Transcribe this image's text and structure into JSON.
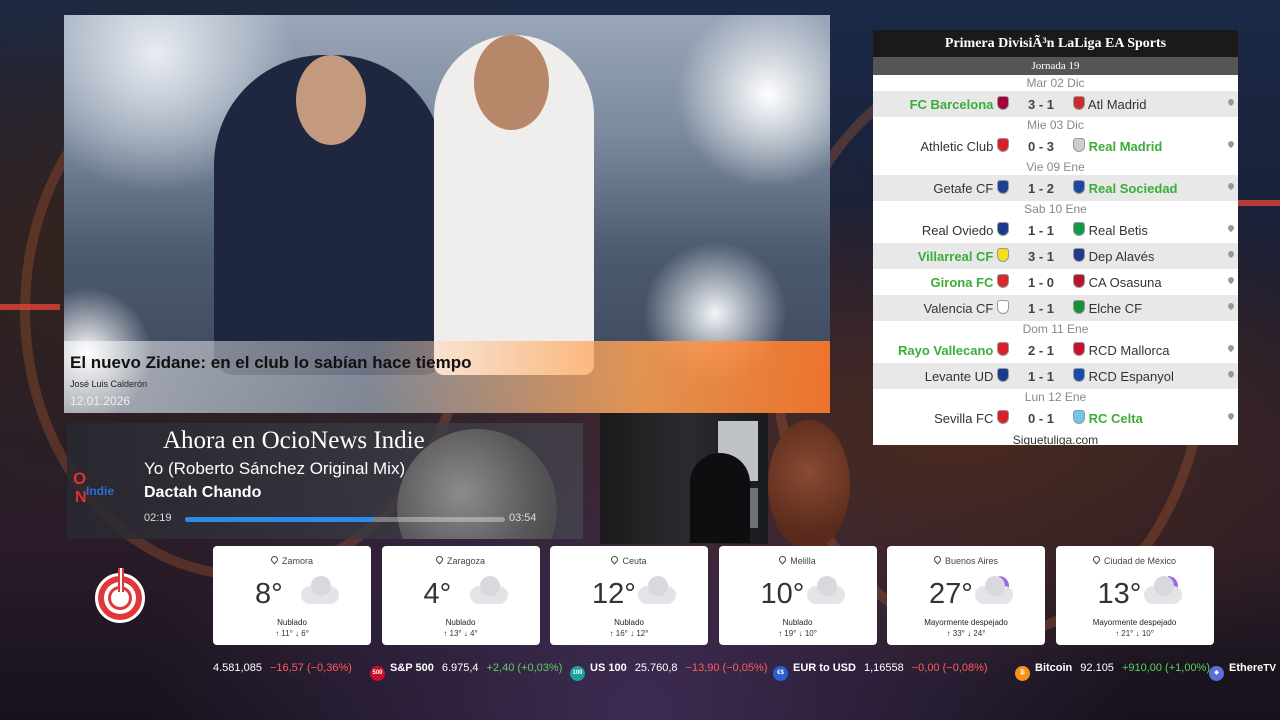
{
  "news": {
    "title": "El nuevo Zidane: en el club lo sabían hace tiempo",
    "author": "José Luis Calderón",
    "date": "12.01.2026"
  },
  "league": {
    "title": "Primera DivisiÃ³n LaLiga EA Sports",
    "round": "Jornada 19",
    "footer": "Siguetuliga.com",
    "days": [
      {
        "date": "Mar 02 Dic",
        "matches": [
          {
            "home": "FC Barcelona",
            "score": "3 - 1",
            "away": "Atl Madrid",
            "winner": "home",
            "home_color": "#a5003c",
            "away_color": "#cc2b2b"
          }
        ]
      },
      {
        "date": "Mie 03 Dic",
        "matches": [
          {
            "home": "Athletic Club",
            "score": "0 - 3",
            "away": "Real Madrid",
            "winner": "away",
            "home_color": "#d8202a",
            "away_color": "#cccccc"
          }
        ]
      },
      {
        "date": "Vie 09 Ene",
        "matches": [
          {
            "home": "Getafe CF",
            "score": "1 - 2",
            "away": "Real Sociedad",
            "winner": "away",
            "home_color": "#1f3f8f",
            "away_color": "#1a4aa0"
          }
        ]
      },
      {
        "date": "Sab 10 Ene",
        "matches": [
          {
            "home": "Real Oviedo",
            "score": "1 - 1",
            "away": "Real Betis",
            "winner": "none",
            "home_color": "#1c3a8c",
            "away_color": "#0f9a4a"
          },
          {
            "home": "Villarreal CF",
            "score": "3 - 1",
            "away": "Dep Alavés",
            "winner": "home",
            "home_color": "#f2e01a",
            "away_color": "#1f3a8c"
          },
          {
            "home": "Girona FC",
            "score": "1 - 0",
            "away": "CA Osasuna",
            "winner": "home",
            "home_color": "#d72a2a",
            "away_color": "#b5142a"
          },
          {
            "home": "Valencia CF",
            "score": "1 - 1",
            "away": "Elche CF",
            "winner": "none",
            "home_color": "#ffffff",
            "away_color": "#1a8f3a"
          }
        ]
      },
      {
        "date": "Dom 11 Ene",
        "matches": [
          {
            "home": "Rayo Vallecano",
            "score": "2 - 1",
            "away": "RCD Mallorca",
            "winner": "home",
            "home_color": "#d8202a",
            "away_color": "#c8102e"
          },
          {
            "home": "Levante UD",
            "score": "1 - 1",
            "away": "RCD Espanyol",
            "winner": "none",
            "home_color": "#1a3a8c",
            "away_color": "#1a4ab0"
          }
        ]
      },
      {
        "date": "Lun 12 Ene",
        "matches": [
          {
            "home": "Sevilla FC",
            "score": "0 - 1",
            "away": "RC Celta",
            "winner": "away",
            "home_color": "#d8202a",
            "away_color": "#6ec6e8"
          }
        ]
      }
    ]
  },
  "radio": {
    "heading": "Ahora en OcioNews Indie",
    "song": "Yo (Roberto Sánchez Original Mix)",
    "artist": "Dactah Chando",
    "elapsed": "02:19",
    "duration": "03:54",
    "progress": 0.59,
    "logo_o": "O",
    "logo_n": "N",
    "logo_indie": "Indie"
  },
  "weather": [
    {
      "city": "Zamora",
      "temp": "8°",
      "icon": "cloud-icon",
      "desc": "Nublado",
      "range": "↑ 11°  ↓ 6°"
    },
    {
      "city": "Zaragoza",
      "temp": "4°",
      "icon": "cloud-icon",
      "desc": "Nublado",
      "range": "↑ 13°  ↓ 4°"
    },
    {
      "city": "Ceuta",
      "temp": "12°",
      "icon": "cloud-icon",
      "desc": "Nublado",
      "range": "↑ 16°  ↓ 12°"
    },
    {
      "city": "Melilla",
      "temp": "10°",
      "icon": "cloud-icon",
      "desc": "Nublado",
      "range": "↑ 19°  ↓ 10°"
    },
    {
      "city": "Buenos Aires",
      "temp": "27°",
      "icon": "moon-cloud-icon",
      "desc": "Mayormente despejado",
      "range": "↑ 33°  ↓ 24°"
    },
    {
      "city": "Ciudad de México",
      "temp": "13°",
      "icon": "moon-cloud-icon",
      "desc": "Mayormente despejado",
      "range": "↑ 21°  ↓ 10°"
    }
  ],
  "ticker": [
    {
      "badge": "",
      "name": "",
      "value": "4.581,085",
      "change": "−16,57 (−0,36%)",
      "dir": "neg",
      "badge_color": ""
    },
    {
      "badge": "500",
      "name": "S&P 500",
      "value": "6.975,4",
      "change": "+2,40 (+0,03%)",
      "dir": "pos",
      "badge_color": "#c8102e"
    },
    {
      "badge": "100",
      "name": "US 100",
      "value": "25.760,8",
      "change": "−13,90 (−0,05%)",
      "dir": "neg",
      "badge_color": "#1aa0a0"
    },
    {
      "badge": "€$",
      "name": "EUR to USD",
      "value": "1,16558",
      "change": "−0,00 (−0,08%)",
      "dir": "neg",
      "badge_color": "#2a5fd0"
    },
    {
      "badge": "₿",
      "name": "Bitcoin",
      "value": "92.105",
      "change": "+910,00 (+1,00%)",
      "dir": "pos",
      "badge_color": "#f7931a"
    },
    {
      "badge": "◆",
      "name": "Ethere",
      "value": "",
      "change": "",
      "dir": "pos",
      "badge_color": "#5b6fd8"
    }
  ],
  "ticker_logo": "TV",
  "colors": {
    "winner": "#3aae3a",
    "power": "#e03838",
    "progress": "#2e8ae8"
  }
}
